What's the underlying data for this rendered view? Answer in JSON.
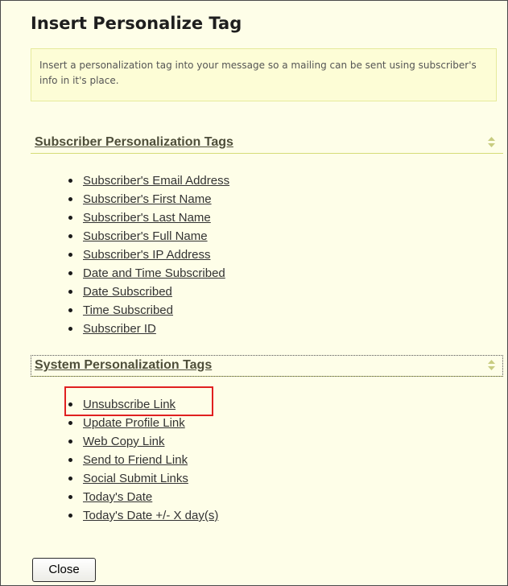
{
  "dialog": {
    "title": "Insert Personalize Tag",
    "info_text": "Insert a personalization tag into your message so a mailing can be sent using subscriber's info in it's place."
  },
  "subscriber_section": {
    "title": "Subscriber Personalization Tags",
    "sort_icon": "sort-arrows-icon",
    "items": [
      "Subscriber's Email Address",
      "Subscriber's First Name",
      "Subscriber's Last Name",
      "Subscriber's Full Name",
      "Subscriber's IP Address",
      "Date and Time Subscribed",
      "Date Subscribed",
      "Time Subscribed",
      "Subscriber ID"
    ]
  },
  "system_section": {
    "title": "System Personalization Tags",
    "sort_icon": "sort-arrows-icon",
    "items": [
      "Unsubscribe Link",
      "Update Profile Link",
      "Web Copy Link",
      "Send to Friend Link",
      "Social Submit Links",
      "Today's Date",
      "Today's Date +/- X day(s)"
    ]
  },
  "footer": {
    "close_label": "Close"
  },
  "colors": {
    "background": "#fefee8",
    "info_box_background": "#fdfdd6",
    "info_box_border": "#e6ea9c",
    "section_rule": "#d6dc78",
    "highlight": "#e02020"
  }
}
